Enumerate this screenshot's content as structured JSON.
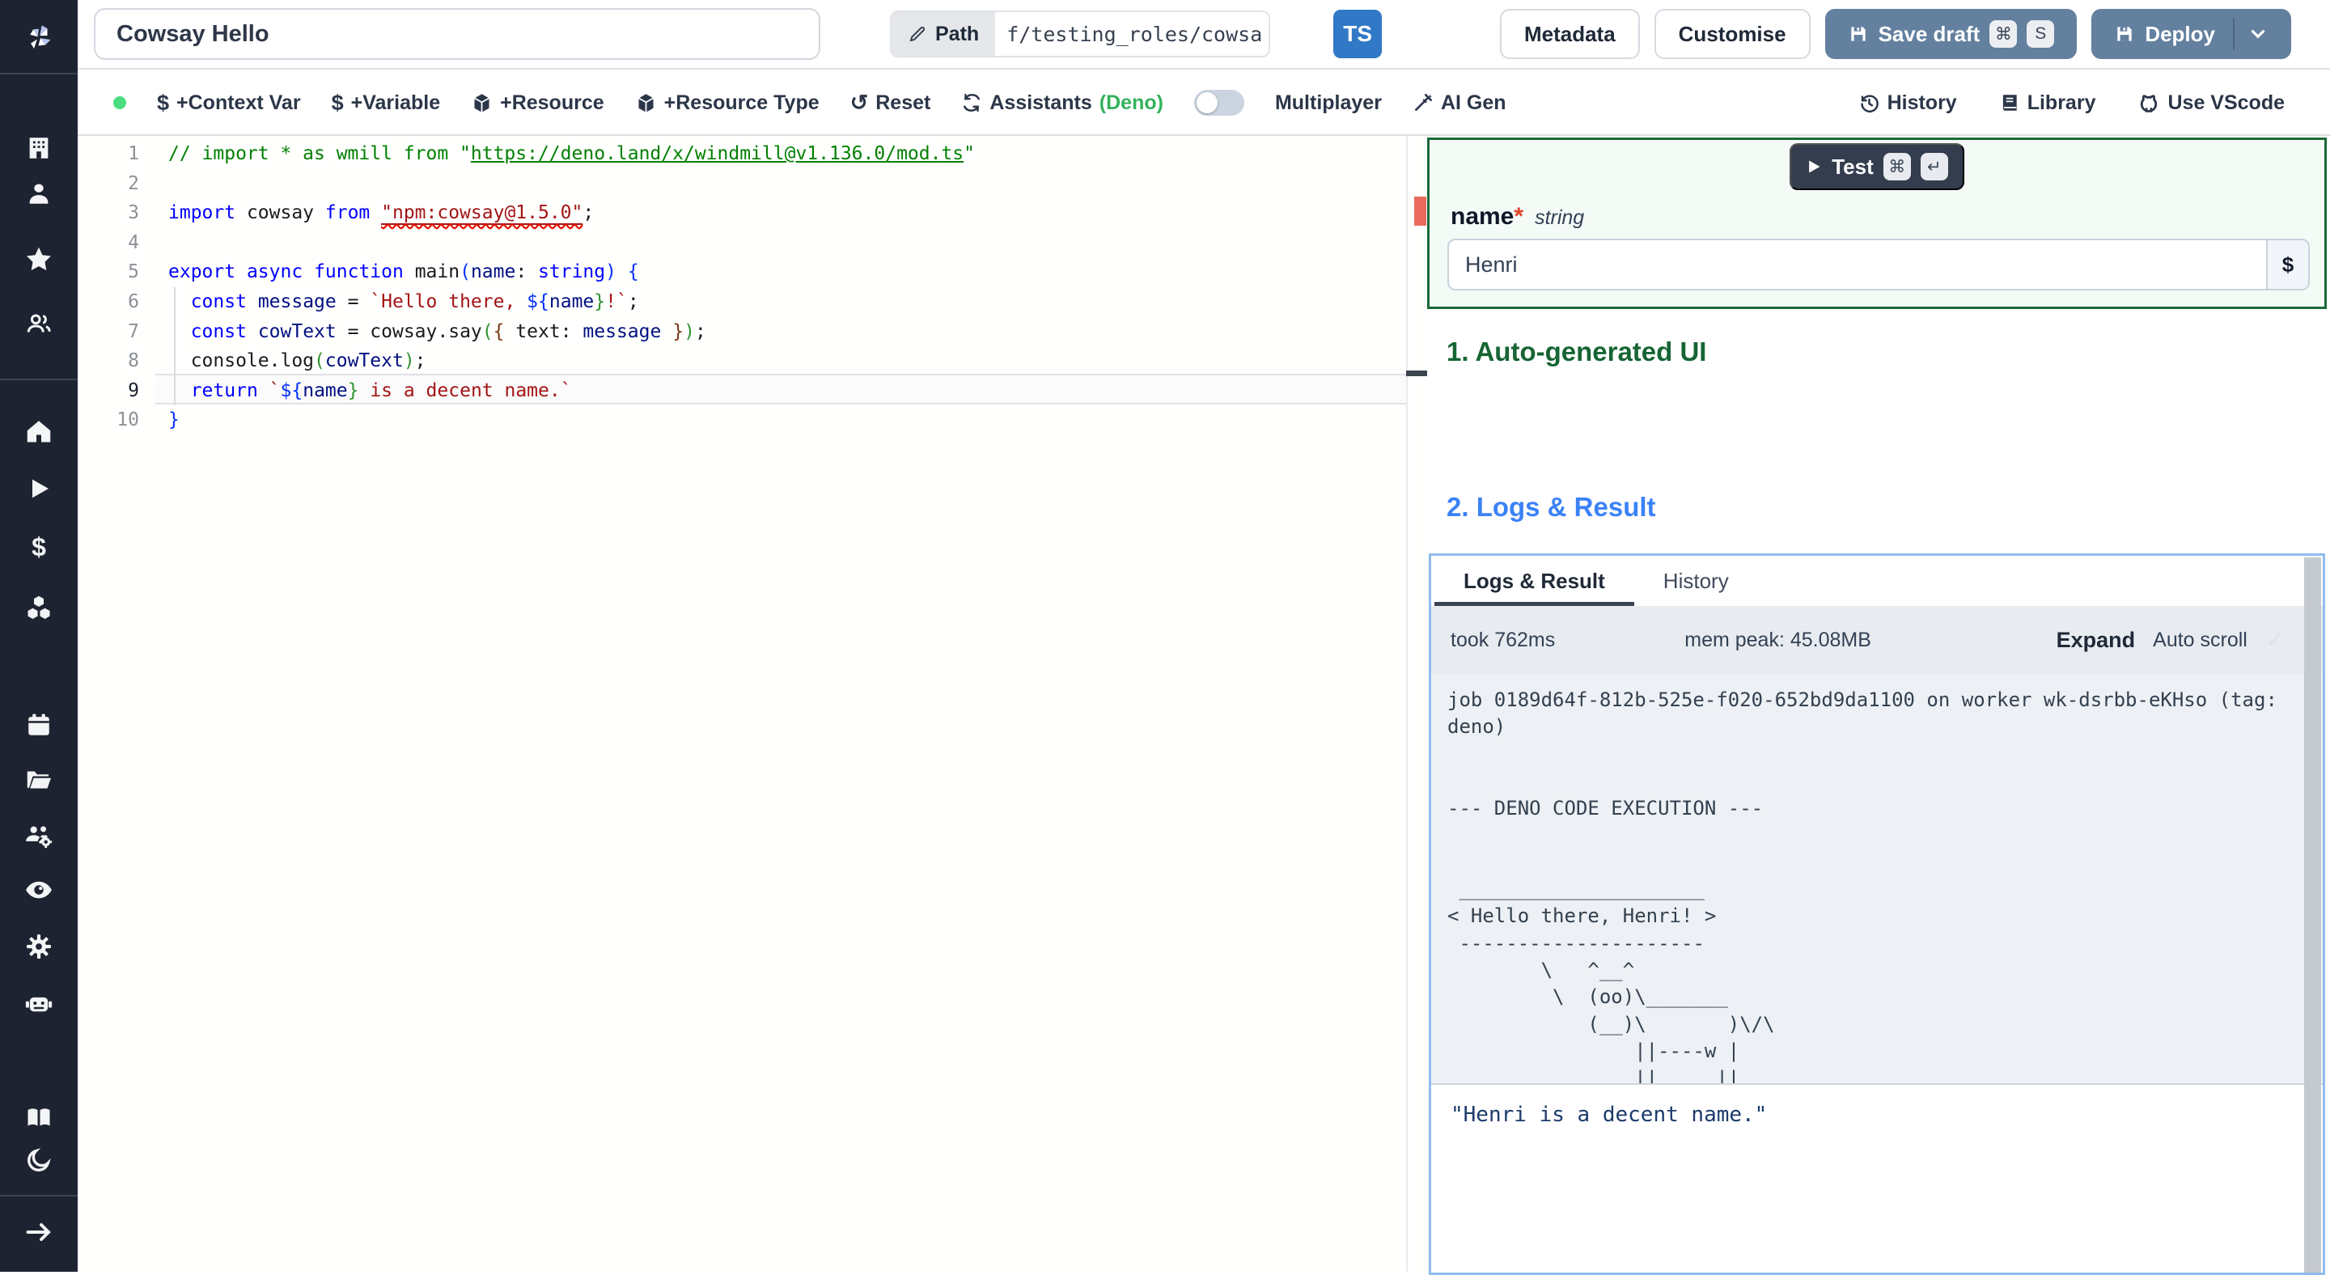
{
  "topbar": {
    "title_value": "Cowsay Hello",
    "path_label": "Path",
    "path_value": "f/testing_roles/cowsa",
    "lang_badge": "TS",
    "metadata": "Metadata",
    "customise": "Customise",
    "save_draft": "Save draft",
    "save_kbd1": "⌘",
    "save_kbd2": "S",
    "deploy": "Deploy"
  },
  "toolbar": {
    "context_var": "+Context Var",
    "variable": "+Variable",
    "resource": "+Resource",
    "resource_type": "+Resource Type",
    "reset": "Reset",
    "assistants": "Assistants",
    "assistants_lang": "(Deno)",
    "multiplayer": "Multiplayer",
    "ai_gen": "AI Gen",
    "history": "History",
    "library": "Library",
    "use_vscode": "Use VScode"
  },
  "editor": {
    "active_line": 9,
    "lines": [
      {
        "n": "1",
        "seg": [
          [
            "// import * as wmill from \"",
            "c"
          ],
          [
            "https://deno.land/x/windmill@v1.136.0/mod.ts",
            "cl"
          ],
          [
            "\"",
            "c"
          ]
        ]
      },
      {
        "n": "2",
        "seg": []
      },
      {
        "n": "3",
        "seg": [
          [
            "import",
            "k"
          ],
          [
            " cowsay ",
            "d"
          ],
          [
            "from",
            "k"
          ],
          [
            " ",
            "d"
          ],
          [
            "\"npm:cowsay@1.5.0\"",
            "sq"
          ],
          [
            ";",
            "d"
          ]
        ]
      },
      {
        "n": "4",
        "seg": []
      },
      {
        "n": "5",
        "seg": [
          [
            "export",
            "k"
          ],
          [
            " ",
            "d"
          ],
          [
            "async",
            "k"
          ],
          [
            " ",
            "d"
          ],
          [
            "function",
            "k"
          ],
          [
            " main",
            "d"
          ],
          [
            "(",
            "b1"
          ],
          [
            "name",
            "v"
          ],
          [
            ": ",
            "d"
          ],
          [
            "string",
            "k"
          ],
          [
            ")",
            "b1"
          ],
          [
            " ",
            "d"
          ],
          [
            "{",
            "b1"
          ]
        ]
      },
      {
        "n": "6",
        "seg": [
          [
            "  ",
            "d"
          ],
          [
            "const",
            "k"
          ],
          [
            " ",
            "d"
          ],
          [
            "message",
            "v"
          ],
          [
            " = ",
            "d"
          ],
          [
            "`Hello there, ",
            "s"
          ],
          [
            "${",
            "b1"
          ],
          [
            "name",
            "v"
          ],
          [
            "}",
            "b2"
          ],
          [
            "!`",
            "s"
          ],
          [
            ";",
            "d"
          ]
        ]
      },
      {
        "n": "7",
        "seg": [
          [
            "  ",
            "d"
          ],
          [
            "const",
            "k"
          ],
          [
            " ",
            "d"
          ],
          [
            "cowText",
            "v"
          ],
          [
            " = cowsay.say",
            "d"
          ],
          [
            "(",
            "b2"
          ],
          [
            "{",
            "b3"
          ],
          [
            " text: ",
            "d"
          ],
          [
            "message",
            "v"
          ],
          [
            " ",
            "d"
          ],
          [
            "}",
            "b3"
          ],
          [
            ")",
            "b2"
          ],
          [
            ";",
            "d"
          ]
        ]
      },
      {
        "n": "8",
        "seg": [
          [
            "  console.log",
            "d"
          ],
          [
            "(",
            "b2"
          ],
          [
            "cowText",
            "v"
          ],
          [
            ")",
            "b2"
          ],
          [
            ";",
            "d"
          ]
        ]
      },
      {
        "n": "9",
        "seg": [
          [
            "  ",
            "d"
          ],
          [
            "return",
            "k"
          ],
          [
            " ",
            "d"
          ],
          [
            "`",
            "s"
          ],
          [
            "${",
            "b1"
          ],
          [
            "name",
            "v"
          ],
          [
            "}",
            "b2"
          ],
          [
            " is a decent name.`",
            "s"
          ]
        ]
      },
      {
        "n": "10",
        "seg": [
          [
            "}",
            "b1"
          ]
        ]
      }
    ]
  },
  "form": {
    "test": "Test",
    "test_kbd1": "⌘",
    "test_kbd2": "↵",
    "field_name": "name",
    "required_mark": "*",
    "field_type": "string",
    "field_value": "Henri",
    "expr_button": "$"
  },
  "sections": {
    "auto_ui": "1. Auto-generated UI",
    "logs_result": "2. Logs & Result"
  },
  "logs_panel": {
    "tabs": [
      "Logs & Result",
      "History"
    ],
    "took": "took 762ms",
    "mem": "mem peak: 45.08MB",
    "expand": "Expand",
    "autoscroll": "Auto scroll",
    "check": "✓",
    "log_lines": [
      "job 0189d64f-812b-525e-f020-652bd9da1100 on worker wk-dsrbb-eKHso (tag: deno)",
      "",
      "",
      "--- DENO CODE EXECUTION ---",
      "",
      "",
      " _____________________",
      "< Hello there, Henri! >",
      " ---------------------",
      "        \\   ^__^",
      "         \\  (oo)\\_______",
      "            (__)\\       )\\/\\",
      "                ||----w |",
      "                ||     ||"
    ],
    "result": "\"Henri is a decent name.\""
  },
  "sidebar": {
    "icons": [
      "windmill-logo",
      "building",
      "user",
      "star",
      "users",
      "home",
      "play",
      "dollar",
      "cubes",
      "calendar",
      "folder",
      "users-gear",
      "eye",
      "gear",
      "robot",
      "books",
      "moon",
      "arrow-right"
    ]
  },
  "colors": {
    "sidebar_bg": "#1d2330",
    "accent_button": "#63809f",
    "green_heading": "#166534",
    "blue_heading": "#3b82f6",
    "green_box_border": "#1b6a39",
    "logs_border": "#90bcec",
    "deno_green": "#35b15c",
    "status_dot": "#4ade80",
    "error_marker": "#ea6a5e",
    "ts_badge": "#3178c6"
  }
}
